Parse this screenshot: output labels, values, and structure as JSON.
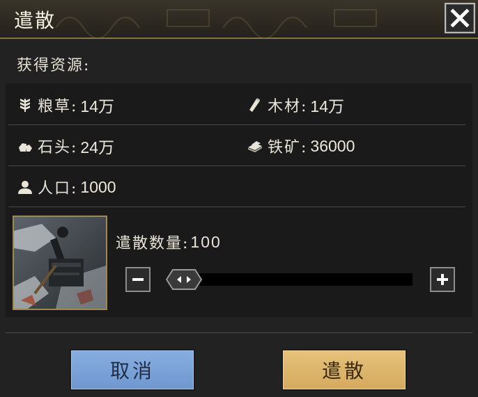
{
  "dialog": {
    "title": "遣散",
    "section_label": "获得资源:"
  },
  "resources": [
    {
      "icon": "wheat-icon",
      "label": "粮草:",
      "value": "14万"
    },
    {
      "icon": "wood-icon",
      "label": "木材:",
      "value": "14万"
    },
    {
      "icon": "stone-icon",
      "label": "石头:",
      "value": "24万"
    },
    {
      "icon": "iron-ore-icon",
      "label": "铁矿:",
      "value": "36000"
    },
    {
      "icon": "population-icon",
      "label": "人口:",
      "value": "1000"
    }
  ],
  "quantity": {
    "label": "遣散数量:",
    "value": "100"
  },
  "buttons": {
    "cancel": "取消",
    "confirm": "遣散"
  },
  "colors": {
    "cancel_button": "#7aa3d8",
    "confirm_button": "#ddb66b",
    "title_border": "#8a7440"
  }
}
